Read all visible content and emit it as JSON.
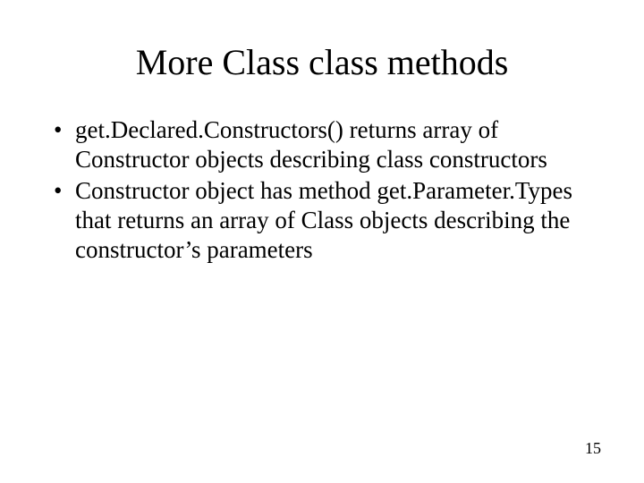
{
  "title": "More Class class methods",
  "bullets": [
    "get.Declared.Constructors() returns array of Constructor objects describing class constructors",
    "Constructor object has method get.Parameter.Types that returns an array of Class objects describing the constructor’s parameters"
  ],
  "page_number": "15"
}
